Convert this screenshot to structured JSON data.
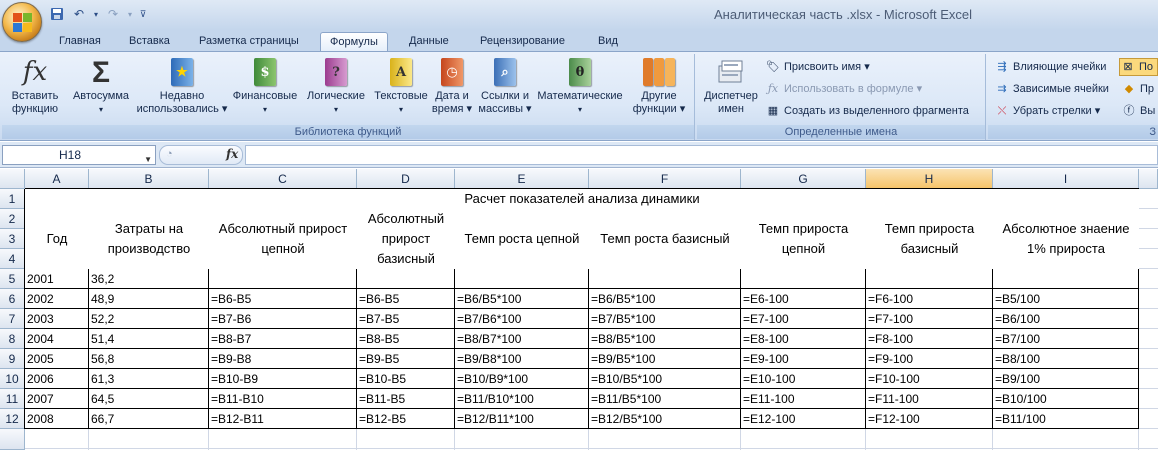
{
  "window": {
    "title": "Аналитическая часть .xlsx - Microsoft Excel"
  },
  "tabs": [
    "Главная",
    "Вставка",
    "Разметка страницы",
    "Формулы",
    "Данные",
    "Рецензирование",
    "Вид"
  ],
  "active_tab": "Формулы",
  "ribbon": {
    "function_library": {
      "label": "Библиотека функций",
      "buttons": [
        {
          "line1": "Вставить",
          "line2": "функцию",
          "icon": "fx-icon"
        },
        {
          "line1": "Автосумма",
          "line2": "▾",
          "icon": "sigma-icon"
        },
        {
          "line1": "Недавно",
          "line2": "использовались ▾",
          "icon": "star-book-icon"
        },
        {
          "line1": "Финансовые",
          "line2": "▾",
          "icon": "money-book-icon"
        },
        {
          "line1": "Логические",
          "line2": "▾",
          "icon": "question-book-icon"
        },
        {
          "line1": "Текстовые",
          "line2": "▾",
          "icon": "text-book-icon"
        },
        {
          "line1": "Дата и",
          "line2": "время ▾",
          "icon": "clock-book-icon"
        },
        {
          "line1": "Ссылки и",
          "line2": "массивы ▾",
          "icon": "magnifier-book-icon"
        },
        {
          "line1": "Математические",
          "line2": "▾",
          "icon": "theta-book-icon"
        },
        {
          "line1": "Другие",
          "line2": "функции ▾",
          "icon": "books-icon"
        }
      ]
    },
    "defined_names": {
      "label": "Определенные имена",
      "manager": {
        "line1": "Диспетчер",
        "line2": "имен"
      },
      "assign": "Присвоить имя ▾",
      "use_in_formula": "Использовать в формуле ▾",
      "create_from_selection": "Создать из выделенного фрагмента"
    },
    "formula_auditing": {
      "trace_precedents": "Влияющие ячейки",
      "trace_dependents": "Зависимые ячейки",
      "remove_arrows": "Убрать стрелки ▾",
      "show_formulas": "По",
      "error_check": "Пр",
      "evaluate": "Вы",
      "group_label_fragment": "З"
    }
  },
  "formula_bar": {
    "name_box": "H18",
    "fx": "fx",
    "content": ""
  },
  "sheet": {
    "columns": [
      "A",
      "B",
      "C",
      "D",
      "E",
      "F",
      "G",
      "H",
      "I"
    ],
    "selected_column": "H",
    "rows": [
      "1",
      "2",
      "3",
      "4",
      "5",
      "6",
      "7",
      "8",
      "9",
      "10",
      "11",
      "12"
    ],
    "title": "Расчет показателей анализа динамики",
    "headers": [
      "Год",
      "Затраты на\nпроизводство",
      "Абсолютный прирост\nцепной",
      "Абсолютный\nприрост\nбазисный",
      "Темп роста цепной",
      "Темп роста базисный",
      "Темп прироста\nцепной",
      "Темп прироста\nбазисный",
      "Абсолютное знаение\n1%  прироста"
    ],
    "data": [
      [
        "2001",
        "36,2",
        "",
        "",
        "",
        "",
        "",
        "",
        ""
      ],
      [
        "2002",
        "48,9",
        "=B6-B5",
        "=B6-B5",
        "=B6/B5*100",
        "=B6/B5*100",
        "=E6-100",
        "=F6-100",
        "=B5/100"
      ],
      [
        "2003",
        "52,2",
        "=B7-B6",
        "=B7-B5",
        "=B7/B6*100",
        "=B7/B5*100",
        "=E7-100",
        "=F7-100",
        "=B6/100"
      ],
      [
        "2004",
        "51,4",
        "=B8-B7",
        "=B8-B5",
        "=B8/B7*100",
        "=B8/B5*100",
        "=E8-100",
        "=F8-100",
        "=B7/100"
      ],
      [
        "2005",
        "56,8",
        "=B9-B8",
        "=B9-B5",
        "=B9/B8*100",
        "=B9/B5*100",
        "=E9-100",
        "=F9-100",
        "=B8/100"
      ],
      [
        "2006",
        "61,3",
        "=B10-B9",
        "=B10-B5",
        "=B10/B9*100",
        "=B10/B5*100",
        "=E10-100",
        "=F10-100",
        "=B9/100"
      ],
      [
        "2007",
        "64,5",
        "=B11-B10",
        "=B11-B5",
        "=B11/B10*100",
        "=B11/B5*100",
        "=E11-100",
        "=F11-100",
        "=B10/100"
      ],
      [
        "2008",
        "66,7",
        "=B12-B11",
        "=B12-B5",
        "=B12/B11*100",
        "=B12/B5*100",
        "=E12-100",
        "=F12-100",
        "=B11/100"
      ]
    ]
  }
}
